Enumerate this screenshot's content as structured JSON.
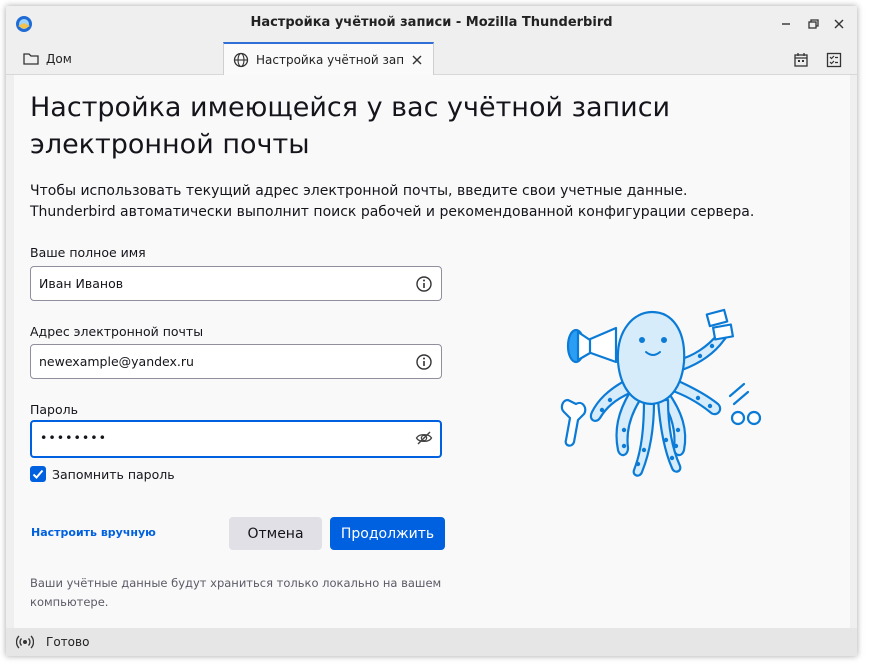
{
  "window": {
    "title": "Настройка учётной записи - Mozilla Thunderbird"
  },
  "tabs": [
    {
      "label": "Дом",
      "icon": "folder-icon"
    },
    {
      "label": "Настройка учётной записи",
      "icon": "globe-icon",
      "active": true
    }
  ],
  "page": {
    "heading": "Настройка имеющейся у вас учётной записи электронной почты",
    "description_line1": "Чтобы использовать текущий адрес электронной почты, введите свои учетные данные.",
    "description_line2": "Thunderbird автоматически выполнит поиск рабочей и рекомендованной конфигурации сервера.",
    "name_label": "Ваше полное имя",
    "name_value": "Иван Иванов",
    "email_label": "Адрес электронной почты",
    "email_value": "newexample@yandex.ru",
    "password_label": "Пароль",
    "password_value": "••••••••",
    "remember_label": "Запомнить пароль",
    "remember_checked": true,
    "manual_link": "Настроить вручную",
    "cancel_button": "Отмена",
    "continue_button": "Продолжить",
    "footnote": "Ваши учётные данные будут храниться только локально на вашем компьютере."
  },
  "status": {
    "text": "Готово"
  },
  "colors": {
    "accent": "#0061e0",
    "octopus": "#cfe9fb",
    "octopus_outline": "#0b7bd6"
  }
}
